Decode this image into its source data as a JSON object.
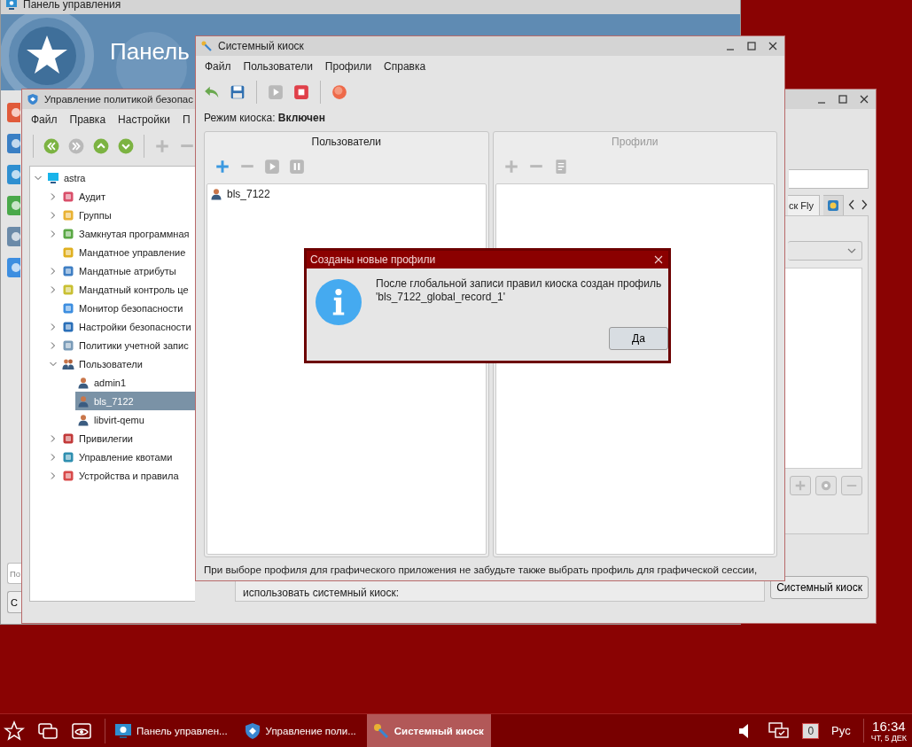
{
  "control_panel": {
    "title": "Панель управления",
    "banner_title": "Панель",
    "search": {
      "placeholder": "По"
    },
    "button": "С"
  },
  "policy_window": {
    "title": "Управление политикой безопас",
    "menu": [
      "Файл",
      "Правка",
      "Настройки",
      "П"
    ],
    "tool_groups": [
      [
        {
          "kind": "first",
          "disabled": false
        },
        {
          "kind": "next",
          "disabled": true
        },
        {
          "kind": "up",
          "disabled": false
        },
        {
          "kind": "down",
          "disabled": false
        }
      ],
      [
        {
          "kind": "add",
          "disabled": true
        },
        {
          "kind": "remove",
          "disabled": true
        }
      ]
    ],
    "tree": [
      {
        "label": "astra",
        "kind": "computer",
        "selected": false,
        "expanded": true,
        "children": [
          {
            "label": "Аудит",
            "kind": "module",
            "selected": false,
            "expanded": false
          },
          {
            "label": "Группы",
            "kind": "module",
            "selected": false,
            "expanded": false
          },
          {
            "label": "Замкнутая программная",
            "kind": "module",
            "selected": false,
            "expanded": false
          },
          {
            "label": "Мандатное управление",
            "kind": "module",
            "selected": false
          },
          {
            "label": "Мандатные атрибуты",
            "kind": "module",
            "selected": false,
            "expanded": false
          },
          {
            "label": "Мандатный контроль це",
            "kind": "module",
            "selected": false,
            "expanded": false
          },
          {
            "label": "Монитор безопасности",
            "kind": "module",
            "selected": false
          },
          {
            "label": "Настройки безопасности",
            "kind": "module",
            "selected": false,
            "expanded": false
          },
          {
            "label": "Политики учетной запис",
            "kind": "module",
            "selected": false,
            "expanded": false
          },
          {
            "label": "Пользователи",
            "kind": "users",
            "selected": false,
            "expanded": true,
            "children": [
              {
                "label": "admin1",
                "kind": "user",
                "selected": false
              },
              {
                "label": "bls_7122",
                "kind": "user",
                "selected": true
              },
              {
                "label": "libvirt-qemu",
                "kind": "user",
                "selected": false
              }
            ]
          },
          {
            "label": "Привилегии",
            "kind": "module",
            "selected": false,
            "expanded": false
          },
          {
            "label": "Управление квотами",
            "kind": "module",
            "selected": false,
            "expanded": false
          },
          {
            "label": "Устройства и правила",
            "kind": "module",
            "selected": false,
            "expanded": false
          }
        ]
      }
    ],
    "tabs": [
      {
        "kind": "text",
        "label": "ск Fly",
        "selected": true
      },
      {
        "kind": "icon",
        "selected": false
      }
    ],
    "panel_tools": [
      {
        "kind": "add",
        "disabled": true
      },
      {
        "kind": "settings",
        "disabled": true
      },
      {
        "kind": "remove",
        "disabled": true
      }
    ],
    "note": "использовать системный киоск:",
    "kiosk_button": "Системный киоск"
  },
  "kiosk_window": {
    "title": "Системный киоск",
    "menu": [
      "Файл",
      "Пользователи",
      "Профили",
      "Справка"
    ],
    "tool_groups": [
      [
        {
          "kind": "undo",
          "disabled": false
        },
        {
          "kind": "save",
          "disabled": false
        }
      ],
      [
        {
          "kind": "play",
          "disabled": true
        },
        {
          "kind": "stop",
          "disabled": false
        }
      ],
      [
        {
          "kind": "record",
          "disabled": false
        }
      ]
    ],
    "mode": "Режим киоска: **Включен**",
    "users_panel": {
      "title": "Пользователи",
      "disabled": false,
      "tools": [
        {
          "kind": "add",
          "disabled": false
        },
        {
          "kind": "remove",
          "disabled": true
        },
        {
          "kind": "play",
          "disabled": true
        },
        {
          "kind": "pause",
          "disabled": true
        }
      ],
      "items": [
        {
          "name": "bls_7122",
          "selected": false
        }
      ]
    },
    "profiles_panel": {
      "title": "Профили",
      "disabled": true,
      "tools": [
        {
          "kind": "add",
          "disabled": true
        },
        {
          "kind": "remove",
          "disabled": true
        },
        {
          "kind": "properties",
          "disabled": true
        }
      ]
    },
    "footer": "При выборе профиля для графического приложения не забудьте также выбрать профиль для графической сессии,"
  },
  "dialog": {
    "title": "Созданы новые профили",
    "message": "После глобальной записи правил киоска создан профиль 'bls_7122_global_record_1'",
    "button": "Да"
  },
  "taskbar": {
    "tasks": [
      {
        "kind": "control",
        "label": "Панель управлен...",
        "selected": false
      },
      {
        "kind": "policy",
        "label": "Управление поли...",
        "selected": false
      },
      {
        "kind": "kiosk",
        "label": "Системный киоск",
        "selected": true
      }
    ],
    "counter": "0",
    "language": "Рус",
    "time": "16:34",
    "date": "ЧТ, 5 ДЕК"
  }
}
